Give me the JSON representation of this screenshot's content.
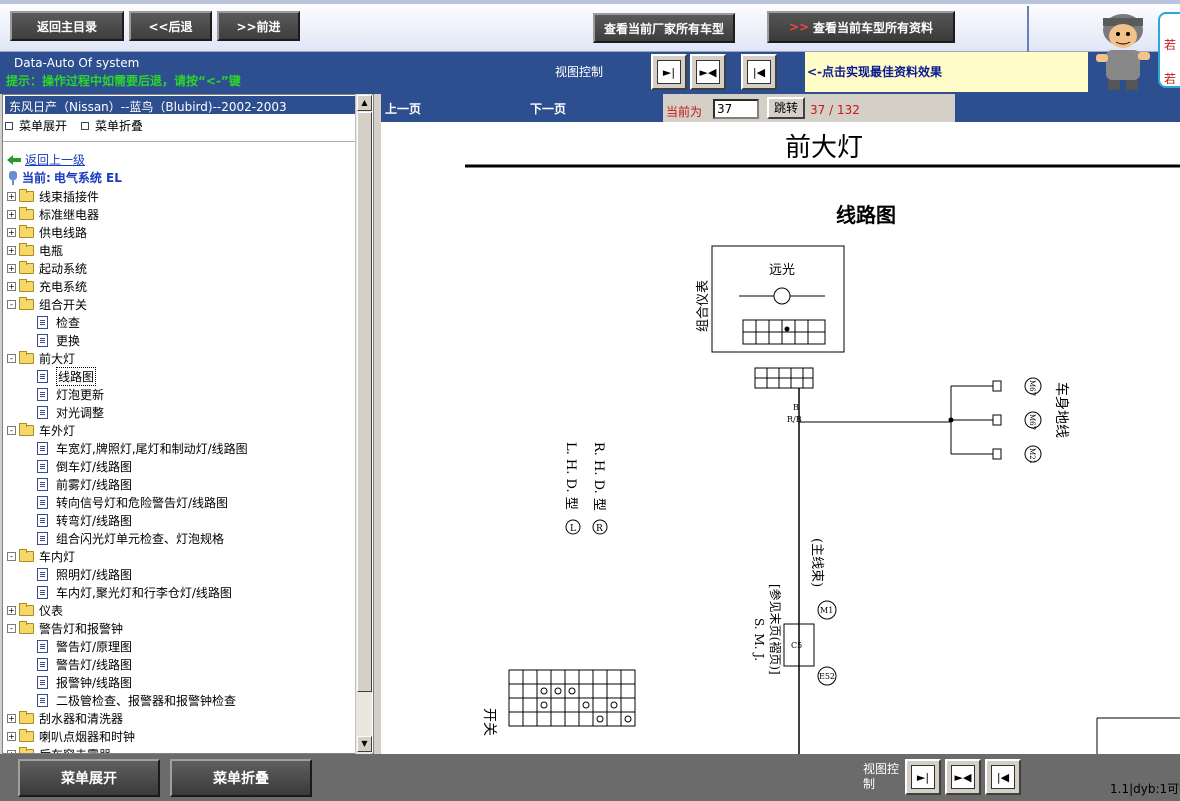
{
  "toolbar": {
    "home": "返回主目录",
    "back": "<<后退",
    "forward": ">>前进",
    "maker_models": "查看当前厂家所有车型",
    "model_all_arrows": ">>",
    "model_all": "查看当前车型所有资料"
  },
  "header": {
    "brand": "Data-Auto Of system",
    "tip": "提示：操作过程中如需要后退，请按“<-”键  ",
    "view_control": "视图控制",
    "hint": "<-点击实现最佳资料效果",
    "side_text_1": "若",
    "side_text_2": "若"
  },
  "tree": {
    "breadcrumb": "东风日产（Nissan）--蓝鸟（Blubird)--2002-2003",
    "expand": "菜单展开",
    "collapse": "菜单折叠",
    "back_link": "返回上一级",
    "current_label": "当前:",
    "current_value": "电气系统  EL",
    "items": [
      {
        "label": "线束插接件",
        "type": "folder",
        "level": 0,
        "state": "+"
      },
      {
        "label": "标准继电器",
        "type": "folder",
        "level": 0,
        "state": "+"
      },
      {
        "label": "供电线路",
        "type": "folder",
        "level": 0,
        "state": "+"
      },
      {
        "label": "电瓶",
        "type": "folder",
        "level": 0,
        "state": "+"
      },
      {
        "label": "起动系统",
        "type": "folder",
        "level": 0,
        "state": "+"
      },
      {
        "label": "充电系统",
        "type": "folder",
        "level": 0,
        "state": "+"
      },
      {
        "label": "组合开关",
        "type": "folder",
        "level": 0,
        "state": "-"
      },
      {
        "label": "检查",
        "type": "doc",
        "level": 1
      },
      {
        "label": "更换",
        "type": "doc",
        "level": 1
      },
      {
        "label": "前大灯",
        "type": "folder",
        "level": 0,
        "state": "-"
      },
      {
        "label": "线路图",
        "type": "doc",
        "level": 1,
        "selected": true
      },
      {
        "label": "灯泡更新",
        "type": "doc",
        "level": 1
      },
      {
        "label": "对光调整",
        "type": "doc",
        "level": 1
      },
      {
        "label": "车外灯",
        "type": "folder",
        "level": 0,
        "state": "-"
      },
      {
        "label": "车宽灯,牌照灯,尾灯和制动灯/线路图",
        "type": "doc",
        "level": 1
      },
      {
        "label": "倒车灯/线路图",
        "type": "doc",
        "level": 1
      },
      {
        "label": "前雾灯/线路图",
        "type": "doc",
        "level": 1
      },
      {
        "label": "转向信号灯和危险警告灯/线路图",
        "type": "doc",
        "level": 1
      },
      {
        "label": "转弯灯/线路图",
        "type": "doc",
        "level": 1
      },
      {
        "label": "组合闪光灯单元检查、灯泡规格",
        "type": "doc",
        "level": 1
      },
      {
        "label": "车内灯",
        "type": "folder",
        "level": 0,
        "state": "-"
      },
      {
        "label": "照明灯/线路图",
        "type": "doc",
        "level": 1
      },
      {
        "label": "车内灯,聚光灯和行李仓灯/线路图",
        "type": "doc",
        "level": 1
      },
      {
        "label": "仪表",
        "type": "folder",
        "level": 0,
        "state": "+"
      },
      {
        "label": "警告灯和报警钟",
        "type": "folder",
        "level": 0,
        "state": "-"
      },
      {
        "label": "警告灯/原理图",
        "type": "doc",
        "level": 1
      },
      {
        "label": "警告灯/线路图",
        "type": "doc",
        "level": 1
      },
      {
        "label": "报警钟/线路图",
        "type": "doc",
        "level": 1
      },
      {
        "label": "二极管检查、报警器和报警钟检查",
        "type": "doc",
        "level": 1
      },
      {
        "label": "刮水器和清洗器",
        "type": "folder",
        "level": 0,
        "state": "+"
      },
      {
        "label": "喇叭点烟器和时钟",
        "type": "folder",
        "level": 0,
        "state": "+"
      },
      {
        "label": "后车窗去雾器",
        "type": "folder",
        "level": 0,
        "state": "+"
      }
    ]
  },
  "pager": {
    "prev": "上一页",
    "next": "下一页",
    "current_label": "当前为",
    "current_value": "37",
    "go": "跳转",
    "count": "37 / 132"
  },
  "diagram": {
    "title": "前大灯",
    "subtitle": "线路图",
    "cluster": "组合仪表",
    "high_beam": "远光",
    "ground": "车身地线",
    "lhd": "L. H. D. 型",
    "rhd": "R. H. D. 型",
    "harness": "(主线束)",
    "smj": "S. M. J.",
    "smj_ref": "[参见末页(褶页)]",
    "switch": "开关",
    "wire_rb": "R/B",
    "wire_b": "B",
    "conn_m1": "M1",
    "conn_c5": "C5",
    "conn_e52": "E52",
    "conn_m67": "M67",
    "conn_m21": "M21",
    "circle_l": "L",
    "circle_r": "R"
  },
  "bottom": {
    "expand": "菜单展开",
    "collapse": "菜单折叠",
    "view_control": "视图控制",
    "status": "1.1|dyb:1可打"
  }
}
